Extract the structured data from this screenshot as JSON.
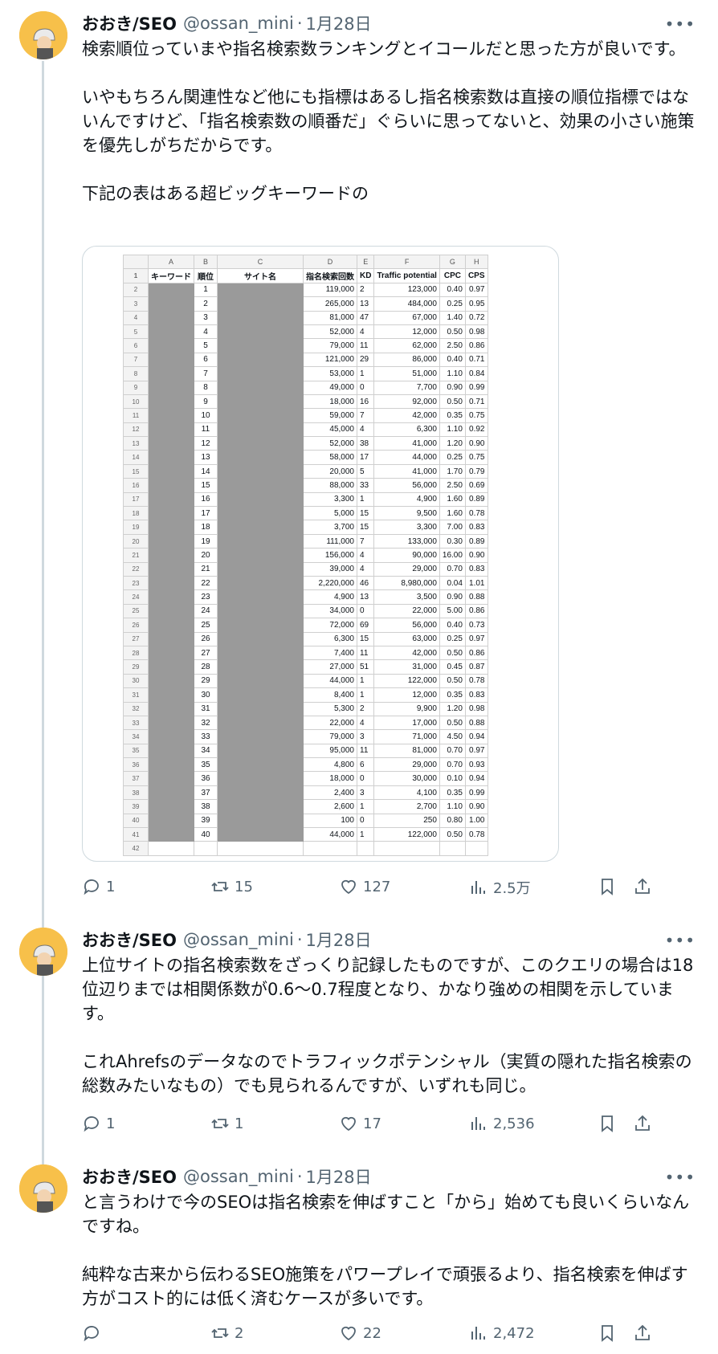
{
  "tweets": [
    {
      "name": "おおき/SEO",
      "handle": "@ossan_mini",
      "date": "1月28日",
      "paragraphs": [
        "検索順位っていまや指名検索数ランキングとイコールだと思った方が良いです。",
        "いやもちろん関連性など他にも指標はあるし指名検索数は直接の順位指標ではないんですけど、「指名検索数の順番だ」ぐらいに思ってないと、効果の小さい施策を優先しがちだからです。",
        "下記の表はある超ビッグキーワードの"
      ],
      "replies": "1",
      "retweets": "15",
      "likes": "127",
      "views": "2.5万"
    },
    {
      "name": "おおき/SEO",
      "handle": "@ossan_mini",
      "date": "1月28日",
      "paragraphs": [
        "上位サイトの指名検索数をざっくり記録したものですが、このクエリの場合は18位辺りまでは相関係数が0.6〜0.7程度となり、かなり強めの相関を示しています。",
        "これAhrefsのデータなのでトラフィックポテンシャル（実質の隠れた指名検索の総数みたいなもの）でも見られるんですが、いずれも同じ。"
      ],
      "replies": "1",
      "retweets": "1",
      "likes": "17",
      "views": "2,536"
    },
    {
      "name": "おおき/SEO",
      "handle": "@ossan_mini",
      "date": "1月28日",
      "paragraphs": [
        "と言うわけで今のSEOは指名検索を伸ばすこと「から」始めても良いくらいなんですね。",
        "純粋な古来から伝わるSEO施策をパワープレイで頑張るより、指名検索を伸ばす方がコスト的には低く済むケースが多いです。"
      ],
      "replies": "",
      "retweets": "2",
      "likes": "22",
      "views": "2,472"
    }
  ],
  "sheet": {
    "col_letters": [
      "A",
      "B",
      "C",
      "D",
      "E",
      "F",
      "G",
      "H"
    ],
    "headers": [
      "キーワード",
      "順位",
      "サイト名",
      "指名検索回数",
      "KD",
      "Traffic potential",
      "CPC",
      "CPS"
    ],
    "rows": [
      [
        "1",
        "119,000",
        "2",
        "123,000",
        "0.40",
        "0.97"
      ],
      [
        "2",
        "265,000",
        "13",
        "484,000",
        "0.25",
        "0.95"
      ],
      [
        "3",
        "81,000",
        "47",
        "67,000",
        "1.40",
        "0.72"
      ],
      [
        "4",
        "52,000",
        "4",
        "12,000",
        "0.50",
        "0.98"
      ],
      [
        "5",
        "79,000",
        "11",
        "62,000",
        "2.50",
        "0.86"
      ],
      [
        "6",
        "121,000",
        "29",
        "86,000",
        "0.40",
        "0.71"
      ],
      [
        "7",
        "53,000",
        "1",
        "51,000",
        "1.10",
        "0.84"
      ],
      [
        "8",
        "49,000",
        "0",
        "7,700",
        "0.90",
        "0.99"
      ],
      [
        "9",
        "18,000",
        "16",
        "92,000",
        "0.50",
        "0.71"
      ],
      [
        "10",
        "59,000",
        "7",
        "42,000",
        "0.35",
        "0.75"
      ],
      [
        "11",
        "45,000",
        "4",
        "6,300",
        "1.10",
        "0.92"
      ],
      [
        "12",
        "52,000",
        "38",
        "41,000",
        "1.20",
        "0.90"
      ],
      [
        "13",
        "58,000",
        "17",
        "44,000",
        "0.25",
        "0.75"
      ],
      [
        "14",
        "20,000",
        "5",
        "41,000",
        "1.70",
        "0.79"
      ],
      [
        "15",
        "88,000",
        "33",
        "56,000",
        "2.50",
        "0.69"
      ],
      [
        "16",
        "3,300",
        "1",
        "4,900",
        "1.60",
        "0.89"
      ],
      [
        "17",
        "5,000",
        "15",
        "9,500",
        "1.60",
        "0.78"
      ],
      [
        "18",
        "3,700",
        "15",
        "3,300",
        "7.00",
        "0.83"
      ],
      [
        "19",
        "111,000",
        "7",
        "133,000",
        "0.30",
        "0.89"
      ],
      [
        "20",
        "156,000",
        "4",
        "90,000",
        "16.00",
        "0.90"
      ],
      [
        "21",
        "39,000",
        "4",
        "29,000",
        "0.70",
        "0.83"
      ],
      [
        "22",
        "2,220,000",
        "46",
        "8,980,000",
        "0.04",
        "1.01"
      ],
      [
        "23",
        "4,900",
        "13",
        "3,500",
        "0.90",
        "0.88"
      ],
      [
        "24",
        "34,000",
        "0",
        "22,000",
        "5.00",
        "0.86"
      ],
      [
        "25",
        "72,000",
        "69",
        "56,000",
        "0.40",
        "0.73"
      ],
      [
        "26",
        "6,300",
        "15",
        "63,000",
        "0.25",
        "0.97"
      ],
      [
        "27",
        "7,400",
        "11",
        "42,000",
        "0.50",
        "0.86"
      ],
      [
        "28",
        "27,000",
        "51",
        "31,000",
        "0.45",
        "0.87"
      ],
      [
        "29",
        "44,000",
        "1",
        "122,000",
        "0.50",
        "0.78"
      ],
      [
        "30",
        "8,400",
        "1",
        "12,000",
        "0.35",
        "0.83"
      ],
      [
        "31",
        "5,300",
        "2",
        "9,900",
        "1.20",
        "0.98"
      ],
      [
        "32",
        "22,000",
        "4",
        "17,000",
        "0.50",
        "0.88"
      ],
      [
        "33",
        "79,000",
        "3",
        "71,000",
        "4.50",
        "0.94"
      ],
      [
        "34",
        "95,000",
        "11",
        "81,000",
        "0.70",
        "0.97"
      ],
      [
        "35",
        "4,800",
        "6",
        "29,000",
        "0.70",
        "0.93"
      ],
      [
        "36",
        "18,000",
        "0",
        "30,000",
        "0.10",
        "0.94"
      ],
      [
        "37",
        "2,400",
        "3",
        "4,100",
        "0.35",
        "0.99"
      ],
      [
        "38",
        "2,600",
        "1",
        "2,700",
        "1.10",
        "0.90"
      ],
      [
        "39",
        "100",
        "0",
        "250",
        "0.80",
        "1.00"
      ],
      [
        "40",
        "44,000",
        "1",
        "122,000",
        "0.50",
        "0.78"
      ]
    ]
  }
}
